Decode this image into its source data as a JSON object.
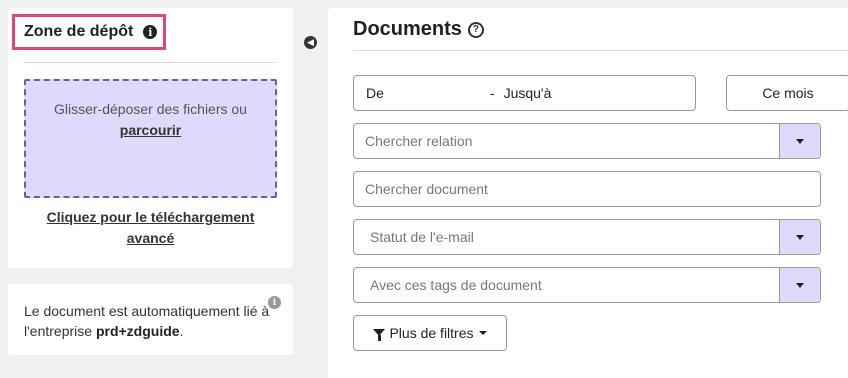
{
  "dropzone_panel": {
    "title": "Zone de dépôt",
    "drag_text": "Glisser-déposer des fichiers ou",
    "browse_link": "parcourir",
    "advanced_upload_link": "Cliquez pour le téléchargement avancé"
  },
  "info_panel": {
    "text_prefix": "Le document est automatiquement lié à l'entreprise",
    "company": "prd+zdguide",
    "text_suffix": "."
  },
  "documents": {
    "title": "Documents",
    "date_from_label": "De",
    "date_separator": "-",
    "date_to_label": "Jusqu'à",
    "this_month_button": "Ce mois",
    "search_relation_placeholder": "Chercher relation",
    "search_document_placeholder": "Chercher document",
    "email_status_placeholder": "Statut de l'e-mail",
    "document_tags_placeholder": "Avec ces tags de document",
    "more_filters_button": "Plus de filtres"
  },
  "colors": {
    "highlight_border": "#e0457b",
    "dropzone_bg": "#e0d9fb",
    "dropdown_button_bg": "#e0d9fb"
  },
  "icons": [
    "info-icon",
    "help-icon",
    "collapse-left-icon",
    "chevron-down-icon",
    "funnel-icon",
    "caret-down-icon"
  ]
}
